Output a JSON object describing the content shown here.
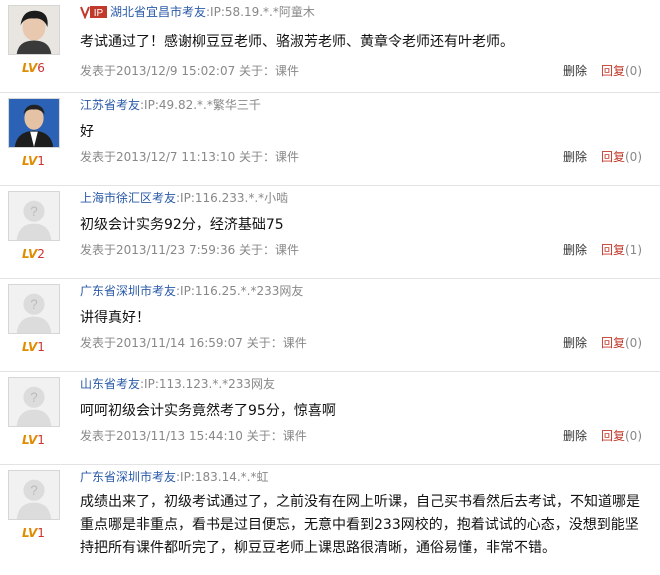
{
  "comments": [
    {
      "vip_label": "IP",
      "location": "湖北省宜昌市考友",
      "ip": ":IP:58.19.*.*阿童木",
      "text": "考试通过了！感谢柳豆豆老师、骆淑芳老师、黄章令老师还有叶老师。",
      "time": "发表于2013/12/9 15:02:07 关于：课件",
      "level_tag": "LV",
      "level": "6",
      "delete_label": "删除",
      "reply_label": "回复",
      "reply_count": "(0)",
      "avatar": "photo-young-man"
    },
    {
      "location": "江苏省考友",
      "ip": ":IP:49.82.*.*繁华三千",
      "text": "好",
      "time": "发表于2013/12/7 11:13:10 关于：课件",
      "level_tag": "LV",
      "level": "1",
      "delete_label": "删除",
      "reply_label": "回复",
      "reply_count": "(0)",
      "avatar": "photo-man-suit"
    },
    {
      "location": "上海市徐汇区考友",
      "ip": ":IP:116.233.*.*小啮",
      "text": "初级会计实务92分，经济基础75",
      "time": "发表于2013/11/23 7:59:36 关于：课件",
      "level_tag": "LV",
      "level": "2",
      "delete_label": "删除",
      "reply_label": "回复",
      "reply_count": "(1)",
      "avatar": "default-avatar"
    },
    {
      "location": "广东省深圳市考友",
      "ip": ":IP:116.25.*.*233网友",
      "text": "讲得真好！",
      "time": "发表于2013/11/14 16:59:07 关于：课件",
      "level_tag": "LV",
      "level": "1",
      "delete_label": "删除",
      "reply_label": "回复",
      "reply_count": "(0)",
      "avatar": "default-avatar"
    },
    {
      "location": "山东省考友",
      "ip": ":IP:113.123.*.*233网友",
      "text": "呵呵初级会计实务竟然考了95分，惊喜啊",
      "time": "发表于2013/11/13 15:44:10 关于：课件",
      "level_tag": "LV",
      "level": "1",
      "delete_label": "删除",
      "reply_label": "回复",
      "reply_count": "(0)",
      "avatar": "default-avatar"
    },
    {
      "location": "广东省深圳市考友",
      "ip": ":IP:183.14.*.*虹",
      "text": "成绩出来了，初级考试通过了，之前没有在网上听课，自己买书看然后去考试，不知道哪是重点哪是非重点，看书是过目便忘，无意中看到233网校的，抱着试试的心态，没想到能坚持把所有课件都听完了，柳豆豆老师上课思路很清晰，通俗易懂，非常不错。",
      "level_tag": "LV",
      "level": "1",
      "avatar": "default-avatar"
    }
  ]
}
